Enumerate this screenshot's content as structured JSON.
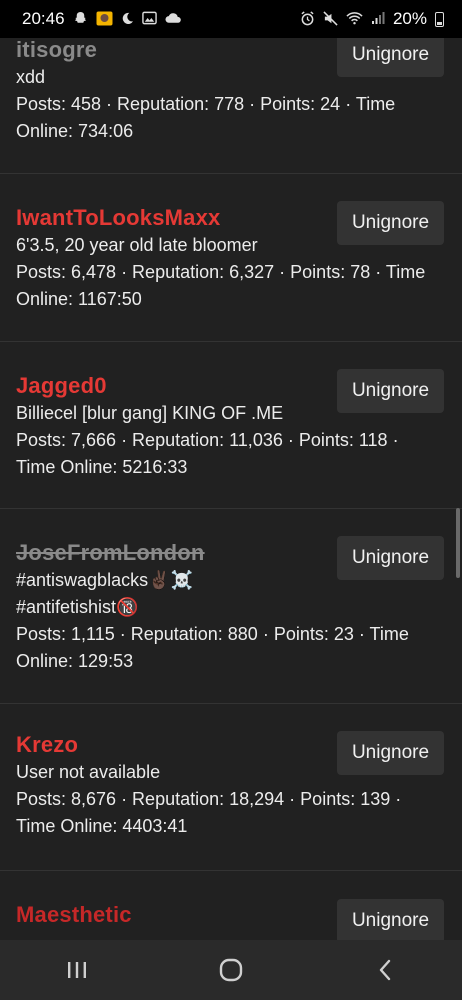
{
  "status_bar": {
    "time": "20:46",
    "battery": "20%",
    "left_icons": [
      "snapchat-icon",
      "photo-app-icon",
      "moon-icon",
      "gallery-icon",
      "cloud-icon"
    ],
    "right_icons": [
      "alarm-icon",
      "mute-icon",
      "wifi-icon",
      "signal-icon",
      "battery-icon"
    ]
  },
  "button_label": "Unignore",
  "users": [
    {
      "name": "itisogre",
      "name_color": "grey",
      "bio_lines": [
        "xdd"
      ],
      "stats_lines": [
        "Posts: 458 · Reputation: 778 · Points: 24 · Time",
        "Online: 734:06"
      ]
    },
    {
      "name": "IwantToLooksMaxx",
      "name_color": "red",
      "bio_lines": [
        "6'3.5, 20 year old late bloomer"
      ],
      "stats_lines": [
        "Posts: 6,478 · Reputation: 6,327 · Points: 78 · Time",
        "Online: 1167:50"
      ]
    },
    {
      "name": "Jagged0",
      "name_color": "red",
      "bio_lines": [
        "Billiecel [blur gang] KING OF .ME"
      ],
      "stats_lines": [
        "Posts: 7,666 · Reputation: 11,036 · Points: 118 ·",
        "Time Online: 5216:33"
      ]
    },
    {
      "name": "JoseFromLondon",
      "name_color": "banned",
      "bio_lines": [
        "#antiswagblacks✌🏿☠️",
        "#antifetishist🔞"
      ],
      "stats_lines": [
        "Posts: 1,115 · Reputation: 880 · Points: 23 · Time",
        "Online: 129:53"
      ]
    },
    {
      "name": "Krezo",
      "name_color": "red",
      "bio_lines": [
        "User not available"
      ],
      "stats_lines": [
        "Posts: 8,676 · Reputation: 18,294 · Points: 139 ·",
        "Time Online: 4403:41"
      ]
    },
    {
      "name": "Maesthetic",
      "name_color": "dark-red",
      "bio_lines": [],
      "stats_lines": []
    }
  ],
  "colors": {
    "background": "#212121",
    "red_username": "#e53935",
    "grey_username": "#8a8a8a",
    "button_bg": "#333333"
  }
}
